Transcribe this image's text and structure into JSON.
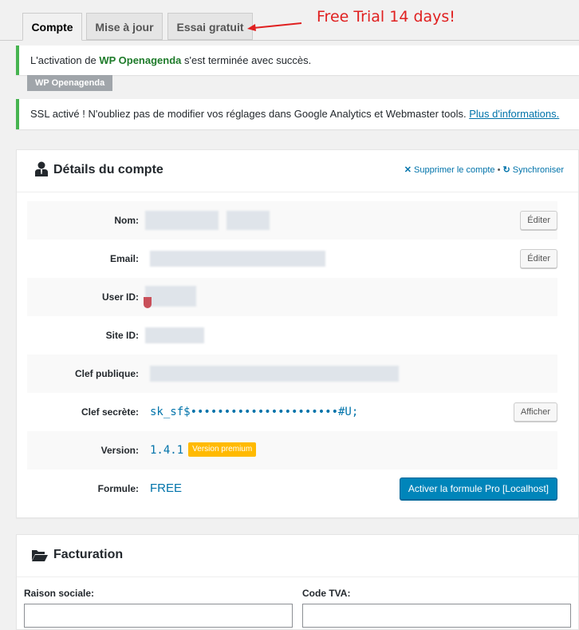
{
  "tabs": [
    "Compte",
    "Mise à jour",
    "Essai gratuit"
  ],
  "annotation": "Free Trial 14 days!",
  "notice_activation": {
    "prefix": "L'activation de ",
    "plugin": "WP Openagenda",
    "suffix": " s'est terminée avec succès."
  },
  "plugin_badge": "WP Openagenda",
  "notice_ssl": {
    "text": "SSL activé ! N'oubliez pas de modifier vos réglages dans Google Analytics et Webmaster tools. ",
    "link": "Plus d'informations."
  },
  "account": {
    "title": "Détails du compte",
    "delete_action": "Supprimer le compte",
    "separator": "•",
    "sync_action": "Synchroniser",
    "rows": {
      "name_label": "Nom:",
      "email_label": "Email:",
      "userid_label": "User ID:",
      "siteid_label": "Site ID:",
      "public_key_label": "Clef publique:",
      "secret_key_label": "Clef secrète:",
      "version_label": "Version:",
      "plan_label": "Formule:"
    },
    "secret_key_value": "sk_sf$••••••••••••••••••••••#U;",
    "version_value": "1.4.1",
    "version_badge": "Version premium",
    "plan_value": "FREE",
    "edit_label": "Éditer",
    "show_label": "Afficher",
    "upgrade_label": "Activer la formule Pro [Localhost]"
  },
  "billing": {
    "title": "Facturation",
    "company_label": "Raison sociale:",
    "vat_label": "Code TVA:"
  },
  "colors": {
    "accent": "#0073aa",
    "success": "#46b450",
    "premium": "#ffba00",
    "primary_button": "#0085ba"
  }
}
